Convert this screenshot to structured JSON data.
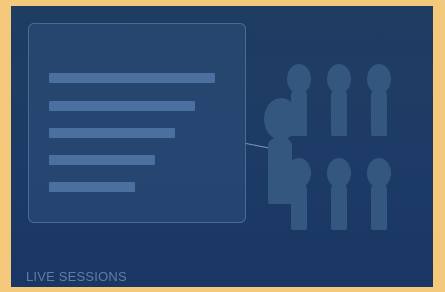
{
  "caption": "LIVE SESSIONS",
  "colors": {
    "frame": "#f5c97c",
    "background": "#1d3b66",
    "screen_fill": "#355784",
    "screen_border": "#7896be",
    "bar": "#4e73a2",
    "figure": "#34577f",
    "caption": "#5d7fa7"
  },
  "scene": {
    "screen_bars": 5,
    "audience_members": 6,
    "presenter": 1
  }
}
